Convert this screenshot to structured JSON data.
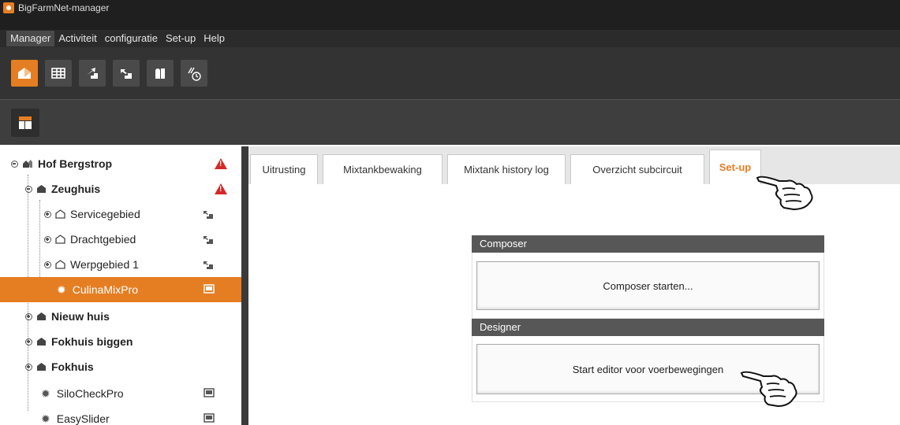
{
  "window": {
    "title": "BigFarmNet-manager"
  },
  "menu": [
    "Manager",
    "Activiteit",
    "configuratie",
    "Set-up",
    "Help"
  ],
  "toolbar_icons": [
    "home-icon",
    "grid-icon",
    "stairs-up-icon",
    "stairs-down-icon",
    "silo-icon",
    "feed-clock-icon"
  ],
  "tree": {
    "root": "Hof Bergstrop",
    "zeughuis": "Zeughuis",
    "servicegebied": "Servicegebied",
    "drachtgebied": "Drachtgebied",
    "werpgebied": "Werpgebied 1",
    "culinamixpro": "CulinaMixPro",
    "nieuw_huis": "Nieuw huis",
    "fokhuis_biggen": "Fokhuis biggen",
    "fokhuis": "Fokhuis",
    "silocheckpro": "SiloCheckPro",
    "easyslider": "EasySlider"
  },
  "tabs": [
    "Uitrusting",
    "Mixtankbewaking",
    "Mixtank history log",
    "Overzicht subcircuit",
    "Set-up"
  ],
  "composer": {
    "header": "Composer",
    "button": "Composer starten..."
  },
  "designer": {
    "header": "Designer",
    "button": "Start editor voor voerbewegingen"
  },
  "colors": {
    "accent": "#e57e22",
    "warning": "#d62828"
  }
}
